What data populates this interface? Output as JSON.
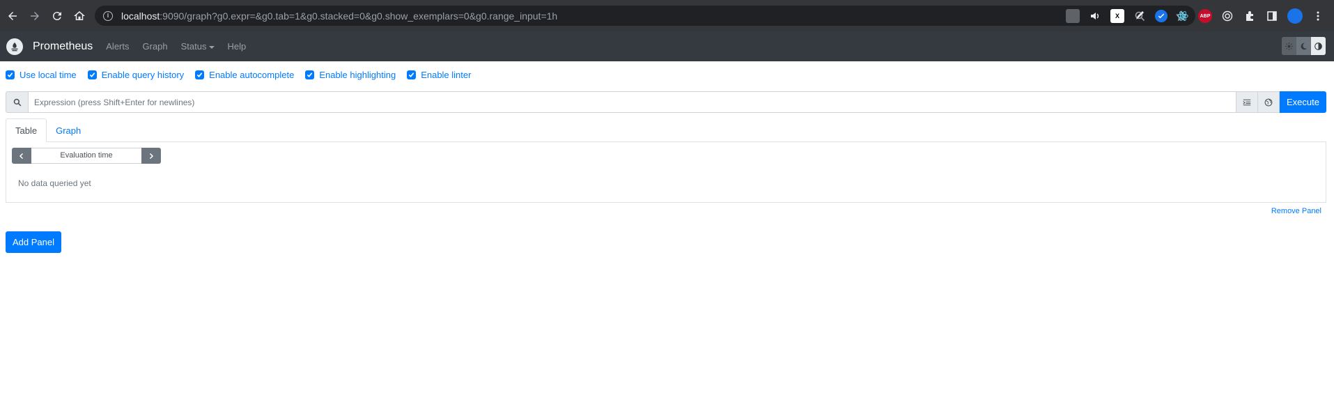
{
  "browser": {
    "url_host": "localhost",
    "url_rest": ":9090/graph?g0.expr=&g0.tab=1&g0.stacked=0&g0.show_exemplars=0&g0.range_input=1h",
    "extensions": [
      "X",
      "ABP"
    ]
  },
  "navbar": {
    "brand": "Prometheus",
    "links": [
      "Alerts",
      "Graph",
      "Status",
      "Help"
    ]
  },
  "options": [
    {
      "label": "Use local time",
      "checked": true
    },
    {
      "label": "Enable query history",
      "checked": true
    },
    {
      "label": "Enable autocomplete",
      "checked": true
    },
    {
      "label": "Enable highlighting",
      "checked": true
    },
    {
      "label": "Enable linter",
      "checked": true
    }
  ],
  "expression": {
    "placeholder": "Expression (press Shift+Enter for newlines)",
    "value": "",
    "execute_label": "Execute"
  },
  "panel": {
    "tabs": [
      "Table",
      "Graph"
    ],
    "active_tab": "Table",
    "eval_time_placeholder": "Evaluation time",
    "no_data": "No data queried yet",
    "remove_label": "Remove Panel"
  },
  "add_panel_label": "Add Panel",
  "colors": {
    "primary": "#007bff",
    "navbar": "#343a40",
    "browser_chrome": "#35363a"
  }
}
